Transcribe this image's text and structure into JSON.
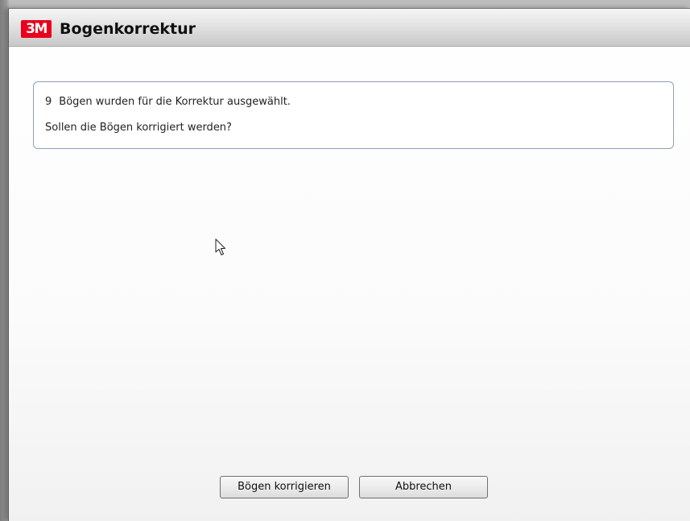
{
  "dialog": {
    "logo_text": "3M",
    "title": "Bogenkorrektur",
    "logo_color": "#e8001c"
  },
  "message": {
    "count": "9",
    "line1": "Bögen wurden für die Korrektur ausgewählt.",
    "line2": "Sollen die Bögen korrigiert werden?"
  },
  "buttons": {
    "correct_label": "Bögen korrigieren",
    "cancel_label": "Abbrechen"
  },
  "icons": {
    "cursor": "mouse-pointer-icon"
  }
}
